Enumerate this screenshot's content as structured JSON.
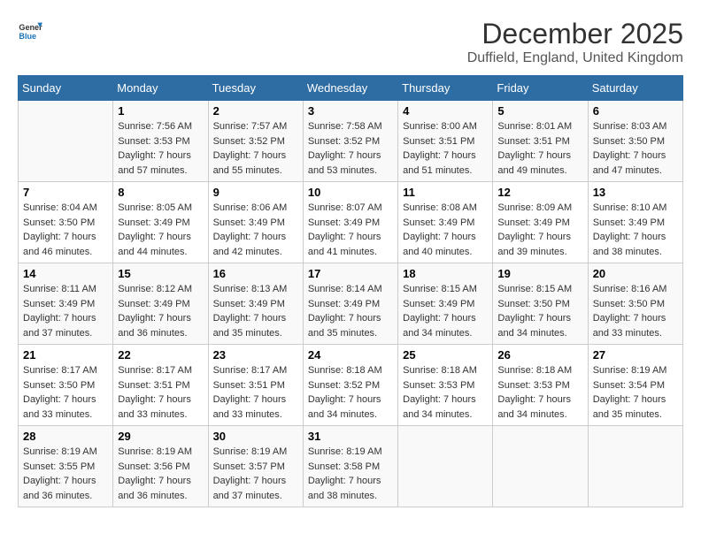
{
  "logo": {
    "line1": "General",
    "line2": "Blue"
  },
  "title": "December 2025",
  "subtitle": "Duffield, England, United Kingdom",
  "days_of_week": [
    "Sunday",
    "Monday",
    "Tuesday",
    "Wednesday",
    "Thursday",
    "Friday",
    "Saturday"
  ],
  "weeks": [
    [
      {
        "day": "",
        "sunrise": "",
        "sunset": "",
        "daylight": ""
      },
      {
        "day": "1",
        "sunrise": "7:56 AM",
        "sunset": "3:53 PM",
        "daylight": "7 hours and 57 minutes."
      },
      {
        "day": "2",
        "sunrise": "7:57 AM",
        "sunset": "3:52 PM",
        "daylight": "7 hours and 55 minutes."
      },
      {
        "day": "3",
        "sunrise": "7:58 AM",
        "sunset": "3:52 PM",
        "daylight": "7 hours and 53 minutes."
      },
      {
        "day": "4",
        "sunrise": "8:00 AM",
        "sunset": "3:51 PM",
        "daylight": "7 hours and 51 minutes."
      },
      {
        "day": "5",
        "sunrise": "8:01 AM",
        "sunset": "3:51 PM",
        "daylight": "7 hours and 49 minutes."
      },
      {
        "day": "6",
        "sunrise": "8:03 AM",
        "sunset": "3:50 PM",
        "daylight": "7 hours and 47 minutes."
      }
    ],
    [
      {
        "day": "7",
        "sunrise": "8:04 AM",
        "sunset": "3:50 PM",
        "daylight": "7 hours and 46 minutes."
      },
      {
        "day": "8",
        "sunrise": "8:05 AM",
        "sunset": "3:49 PM",
        "daylight": "7 hours and 44 minutes."
      },
      {
        "day": "9",
        "sunrise": "8:06 AM",
        "sunset": "3:49 PM",
        "daylight": "7 hours and 42 minutes."
      },
      {
        "day": "10",
        "sunrise": "8:07 AM",
        "sunset": "3:49 PM",
        "daylight": "7 hours and 41 minutes."
      },
      {
        "day": "11",
        "sunrise": "8:08 AM",
        "sunset": "3:49 PM",
        "daylight": "7 hours and 40 minutes."
      },
      {
        "day": "12",
        "sunrise": "8:09 AM",
        "sunset": "3:49 PM",
        "daylight": "7 hours and 39 minutes."
      },
      {
        "day": "13",
        "sunrise": "8:10 AM",
        "sunset": "3:49 PM",
        "daylight": "7 hours and 38 minutes."
      }
    ],
    [
      {
        "day": "14",
        "sunrise": "8:11 AM",
        "sunset": "3:49 PM",
        "daylight": "7 hours and 37 minutes."
      },
      {
        "day": "15",
        "sunrise": "8:12 AM",
        "sunset": "3:49 PM",
        "daylight": "7 hours and 36 minutes."
      },
      {
        "day": "16",
        "sunrise": "8:13 AM",
        "sunset": "3:49 PM",
        "daylight": "7 hours and 35 minutes."
      },
      {
        "day": "17",
        "sunrise": "8:14 AM",
        "sunset": "3:49 PM",
        "daylight": "7 hours and 35 minutes."
      },
      {
        "day": "18",
        "sunrise": "8:15 AM",
        "sunset": "3:49 PM",
        "daylight": "7 hours and 34 minutes."
      },
      {
        "day": "19",
        "sunrise": "8:15 AM",
        "sunset": "3:50 PM",
        "daylight": "7 hours and 34 minutes."
      },
      {
        "day": "20",
        "sunrise": "8:16 AM",
        "sunset": "3:50 PM",
        "daylight": "7 hours and 33 minutes."
      }
    ],
    [
      {
        "day": "21",
        "sunrise": "8:17 AM",
        "sunset": "3:50 PM",
        "daylight": "7 hours and 33 minutes."
      },
      {
        "day": "22",
        "sunrise": "8:17 AM",
        "sunset": "3:51 PM",
        "daylight": "7 hours and 33 minutes."
      },
      {
        "day": "23",
        "sunrise": "8:17 AM",
        "sunset": "3:51 PM",
        "daylight": "7 hours and 33 minutes."
      },
      {
        "day": "24",
        "sunrise": "8:18 AM",
        "sunset": "3:52 PM",
        "daylight": "7 hours and 34 minutes."
      },
      {
        "day": "25",
        "sunrise": "8:18 AM",
        "sunset": "3:53 PM",
        "daylight": "7 hours and 34 minutes."
      },
      {
        "day": "26",
        "sunrise": "8:18 AM",
        "sunset": "3:53 PM",
        "daylight": "7 hours and 34 minutes."
      },
      {
        "day": "27",
        "sunrise": "8:19 AM",
        "sunset": "3:54 PM",
        "daylight": "7 hours and 35 minutes."
      }
    ],
    [
      {
        "day": "28",
        "sunrise": "8:19 AM",
        "sunset": "3:55 PM",
        "daylight": "7 hours and 36 minutes."
      },
      {
        "day": "29",
        "sunrise": "8:19 AM",
        "sunset": "3:56 PM",
        "daylight": "7 hours and 36 minutes."
      },
      {
        "day": "30",
        "sunrise": "8:19 AM",
        "sunset": "3:57 PM",
        "daylight": "7 hours and 37 minutes."
      },
      {
        "day": "31",
        "sunrise": "8:19 AM",
        "sunset": "3:58 PM",
        "daylight": "7 hours and 38 minutes."
      },
      {
        "day": "",
        "sunrise": "",
        "sunset": "",
        "daylight": ""
      },
      {
        "day": "",
        "sunrise": "",
        "sunset": "",
        "daylight": ""
      },
      {
        "day": "",
        "sunrise": "",
        "sunset": "",
        "daylight": ""
      }
    ]
  ],
  "labels": {
    "sunrise": "Sunrise:",
    "sunset": "Sunset:",
    "daylight": "Daylight:"
  }
}
